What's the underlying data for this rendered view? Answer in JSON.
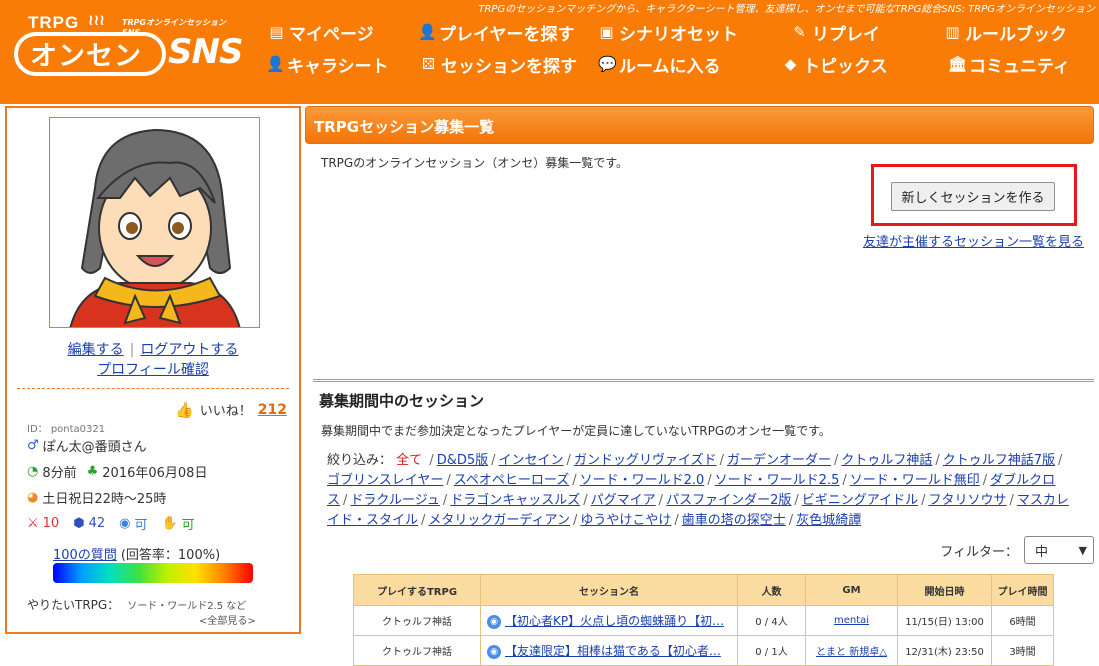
{
  "header": {
    "tagline": "TRPGのセッションマッチングから、キャラクターシート管理、友達探し、オンセまで可能なTRPG総合SNS: TRPGオンラインセッション",
    "logo": {
      "trpg": "TRPG",
      "sub": "TRPGオンラインセッションSNS",
      "onsen": "オンセン",
      "sns": "SNS"
    },
    "nav": [
      {
        "label": "マイページ",
        "icon": "mypage-icon",
        "glyph": "▤"
      },
      {
        "label": "プレイヤーを探す",
        "icon": "player-search-icon",
        "glyph": "👤"
      },
      {
        "label": "シナリオセット",
        "icon": "scenario-icon",
        "glyph": "▣"
      },
      {
        "label": "リプレイ",
        "icon": "replay-icon",
        "glyph": "✎"
      },
      {
        "label": "ルールブック",
        "icon": "rulebook-icon",
        "glyph": "▥"
      },
      {
        "label": "キャラシート",
        "icon": "charasheet-icon",
        "glyph": "👤"
      },
      {
        "label": "セッションを探す",
        "icon": "dice-icon",
        "glyph": "⚄"
      },
      {
        "label": "ルームに入る",
        "icon": "room-icon",
        "glyph": "💬"
      },
      {
        "label": "トピックス",
        "icon": "tag-icon",
        "glyph": "◆"
      },
      {
        "label": "コミュニティ",
        "icon": "community-icon",
        "glyph": "🏛"
      }
    ]
  },
  "profile": {
    "edit": "編集する",
    "logout": "ログアウトする",
    "confirm": "プロフィール確認",
    "likes_label": "いいね！",
    "likes_count": "212",
    "id": "ID： ponta0321",
    "name": "ぽん太@番頭さん",
    "last_login": "8分前",
    "registered": "2016年06月08日",
    "play_time": "土日祝日22時〜25時",
    "stat_attack": "10",
    "stat_dice": "42",
    "stat_voice": "可",
    "stat_hand": "可",
    "questions_link": "100の質問",
    "questions_rate": "(回答率：100%)",
    "want_label": "やりたいTRPG：",
    "want_value": "ソード・ワールド2.5 など",
    "show_all": "<全部見る>",
    "colors": {
      "border": "#f07a20"
    }
  },
  "main": {
    "title": "TRPGセッション募集一覧",
    "intro": "TRPGのオンラインセッション（オンセ）募集一覧です。",
    "new_button": "新しくセッションを作る",
    "friend_link": "友達が主催するセッション一覧を見る",
    "section_title": "募集期間中のセッション",
    "section_desc": "募集期間中でまだ参加決定となったプレイヤーが定員に達していないTRPGのオンセ一覧です。",
    "filter_label": "絞り込み：",
    "filter_all": "全て",
    "filters": [
      "D&D5版",
      "インセイン",
      "ガンドッグリヴァイズド",
      "ガーデンオーダー",
      "クトゥルフ神話",
      "クトゥルフ神話7版",
      "ゴブリンスレイヤー",
      "スペオペヒーローズ",
      "ソード・ワールド2.0",
      "ソード・ワールド2.5",
      "ソード・ワールド無印",
      "ダブルクロス",
      "ドラクルージュ",
      "ドラゴンキャッスルズ",
      "パグマイア",
      "パスファインダー2版",
      "ビギニングアイドル",
      "フタリソウサ",
      "マスカレイド・スタイル",
      "メタリックガーディアン",
      "ゆうやけこやけ",
      "歯車の塔の探空士",
      "灰色城綺譚"
    ],
    "filter_select_label": "フィルター：",
    "filter_select_value": "中"
  },
  "table": {
    "headers": [
      "プレイするTRPG",
      "セッション名",
      "人数",
      "GM",
      "開始日時",
      "プレイ時間"
    ],
    "rows": [
      {
        "system": "クトゥルフ神話",
        "name": "【初心者KP】火点し頃の蜘蛛踊り【初…",
        "players": "0 / 4人",
        "gm": "mentai",
        "start": "11/15(日) 13:00",
        "duration": "6時間"
      },
      {
        "system": "クトゥルフ神話",
        "name": "【友達限定】相棒は猫である【初心者…",
        "players": "0 / 1人",
        "gm": "とまと 新規卓△",
        "start": "12/31(木) 23:50",
        "duration": "3時間"
      }
    ]
  }
}
